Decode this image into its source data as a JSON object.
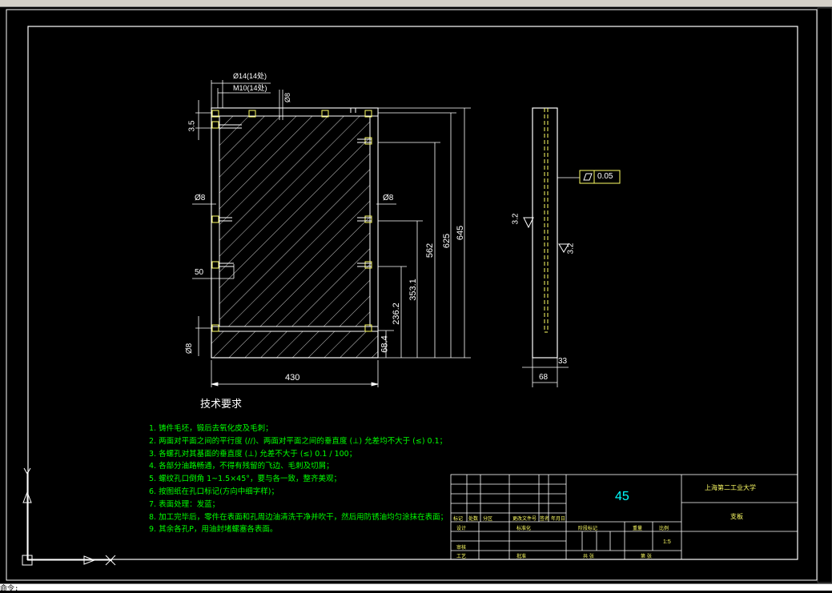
{
  "drawing": {
    "material": "45",
    "school": "上海第二工业大学",
    "part_name": "支板",
    "scale": "1:5"
  },
  "dimensions": {
    "width_430": "430",
    "dia14": "Ø14(14处)",
    "m10": "M10(14处)",
    "dia8_top": "Ø8",
    "dia8_left": "Ø8",
    "dia8_right": "Ø8",
    "dia8_bottom": "Ø8",
    "d35": "3.5",
    "d50": "50",
    "d645": "645",
    "d625": "625",
    "d562": "562",
    "d353": "353.1",
    "d236": "236.2",
    "d68": "68.4",
    "side_68": "68",
    "side_33": "33",
    "rough1": "3.2",
    "rough2": "3.2",
    "flatness": "0.05"
  },
  "tech_requirements": {
    "title": "技术要求",
    "items": [
      "1. 铸件毛坯，锻后去氧化皮及毛刺；",
      "2. 两面对平面之间的平行度 (//)、两面对平面之间的垂直度 (⊥) 允差均不大于 (≤) 0.1；",
      "3. 各螺孔对其基面的垂直度 (⊥) 允差不大于 (≤) 0.1 / 100；",
      "4. 各部分油路畅通，不得有残留的飞边、毛刺及切屑；",
      "5. 螺纹孔口倒角 1~1.5×45°，要与各一致，整齐美观；",
      "6. 按图纸在孔口标记(方向中细字样)；",
      "7. 表面处理：发蓝；",
      "8. 加工完毕后，零件在表面和孔周边油清洗干净并吹干，然后用防锈油均匀涂抹在表面；",
      "9. 其余各孔P，用油封堵螺塞各表面。"
    ]
  },
  "title_block": {
    "row_labels": [
      "标记",
      "处数",
      "分区",
      "更改文件号",
      "签名",
      "年月日"
    ],
    "design": "设计",
    "standard": "标准化",
    "review": "审核",
    "process": "工艺",
    "approve": "批准",
    "stage": "阶段标记",
    "weight": "重量",
    "scale_lbl": "比例",
    "sheets": "共 张",
    "sheet_no": "第 张"
  },
  "status": {
    "command": "命令:"
  }
}
